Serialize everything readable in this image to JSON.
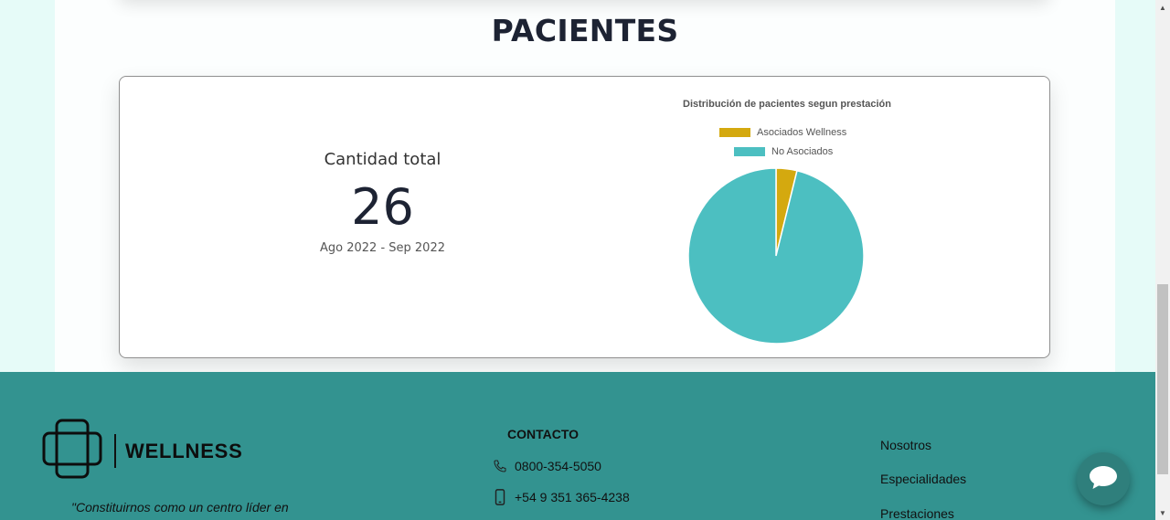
{
  "section": {
    "title": "PACIENTES"
  },
  "stats": {
    "total_label": "Cantidad total",
    "total_value": "26",
    "date_range": "Ago 2022 - Sep 2022"
  },
  "chart_data": {
    "type": "pie",
    "title": "Distribución de pacientes segun prestación",
    "categories": [
      "Asociados Wellness",
      "No Asociados"
    ],
    "values": [
      1,
      25
    ],
    "colors": [
      "#d4a90f",
      "#4cbfc1"
    ],
    "legend_position": "top"
  },
  "footer": {
    "brand": "WELLNESS",
    "quote": "\"Constituirnos como un centro líder en",
    "contact": {
      "title": "CONTACTO",
      "phone": "0800-354-5050",
      "mobile": "+54 9 351 365-4238"
    },
    "nav": [
      "Nosotros",
      "Especialidades",
      "Prestaciones"
    ]
  },
  "icons": {
    "phone": "phone-icon",
    "mobile": "mobile-icon",
    "chat": "chat-bubble-icon",
    "logo": "cross-logo-icon"
  },
  "colors": {
    "footer_bg": "#339390",
    "chat_button": "#2f7f7c",
    "title_text": "#1d2333"
  }
}
